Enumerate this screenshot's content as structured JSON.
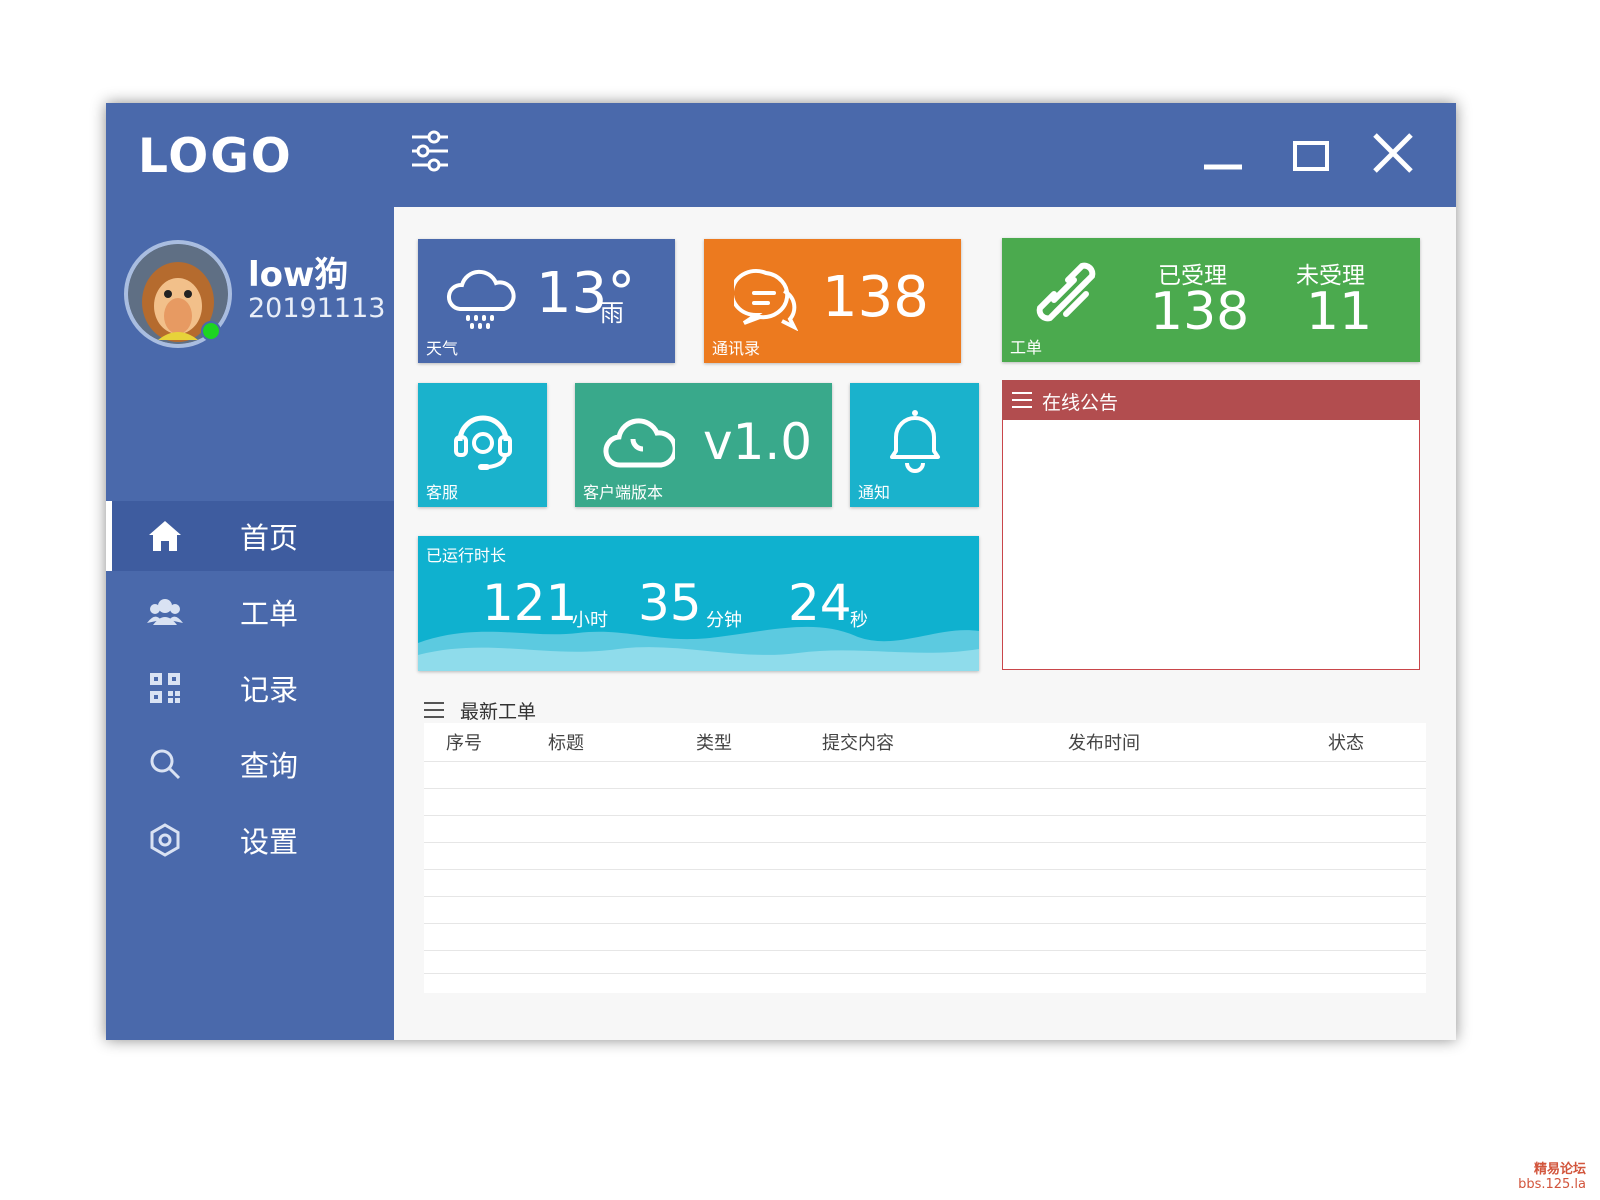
{
  "titlebar": {
    "logo": "LOGO"
  },
  "user": {
    "name": "low狗",
    "id": "20191113"
  },
  "nav": [
    {
      "label": "首页",
      "icon": "home-icon",
      "active": true
    },
    {
      "label": "工单",
      "icon": "users-icon",
      "active": false
    },
    {
      "label": "记录",
      "icon": "qr-code-icon",
      "active": false
    },
    {
      "label": "查询",
      "icon": "search-icon",
      "active": false
    },
    {
      "label": "设置",
      "icon": "settings-hexagon-icon",
      "active": false
    }
  ],
  "tiles": {
    "weather": {
      "temp": "13°",
      "condition": "雨",
      "label": "天气",
      "color": "#4a69ab"
    },
    "contacts": {
      "value": "138",
      "label": "通讯录",
      "color": "#ec7a1f"
    },
    "orders": {
      "accepted_label": "已受理",
      "accepted_value": "138",
      "pending_label": "未受理",
      "pending_value": "11",
      "label": "工单",
      "color": "#4baa4e"
    },
    "service": {
      "label": "客服",
      "color": "#1ab2cc"
    },
    "version": {
      "value": "v1.0",
      "label": "客户端版本",
      "color": "#39a98b"
    },
    "notify": {
      "label": "通知",
      "color": "#1ab2cc"
    },
    "uptime": {
      "label": "已运行时长",
      "hours": "121",
      "hours_unit": "小时",
      "minutes": "35",
      "minutes_unit": "分钟",
      "seconds": "24",
      "seconds_unit": "秒",
      "color": "#0fb1cf"
    }
  },
  "notice": {
    "title": "在线公告",
    "color": "#b24d4f"
  },
  "latest_orders": {
    "title": "最新工单",
    "columns": [
      "序号",
      "标题",
      "类型",
      "提交内容",
      "发布时间",
      "状态"
    ],
    "rows": []
  },
  "watermark": {
    "line1": "精易论坛",
    "line2": "bbs.125.la"
  }
}
